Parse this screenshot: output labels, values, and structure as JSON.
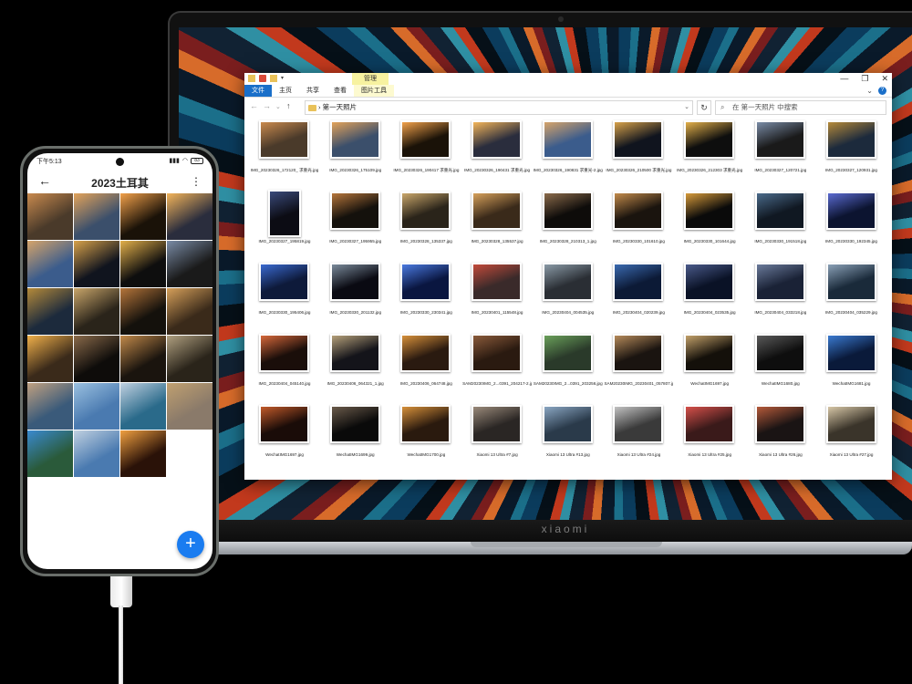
{
  "laptop": {
    "brand": "xiaomi"
  },
  "explorer": {
    "ctx_tab": "管理",
    "tabs": [
      "文件",
      "主页",
      "共享",
      "查看",
      "图片工具"
    ],
    "address": "› 第一天照片",
    "search_placeholder": "在 第一天照片 中搜索",
    "files": [
      {
        "name": "IMG_20230326_172120_ 求重光.jpg",
        "c": [
          "#4a3a2a",
          "#c98a4e"
        ]
      },
      {
        "name": "IMG_20230326_175109.jpg",
        "c": [
          "#3b4f6b",
          "#e3a35a"
        ]
      },
      {
        "name": "IMG_20230326_190417 求重光.jpg",
        "c": [
          "#1a1208",
          "#f2a14a"
        ]
      },
      {
        "name": "IMG_20230326_190431 求重光.jpg",
        "c": [
          "#2a2d3d",
          "#f4b55a"
        ]
      },
      {
        "name": "IMG_20230326_190831 求重光-2.jpg",
        "c": [
          "#3b5c8c",
          "#d6a46a"
        ]
      },
      {
        "name": "IMG_20230326_210500 求重光.jpg",
        "c": [
          "#10141e",
          "#d8a24a"
        ]
      },
      {
        "name": "IMG_20230326_212303 求重光.jpg",
        "c": [
          "#0e0e0e",
          "#e3b04a"
        ]
      },
      {
        "name": "IMG_20230327_120721.jpg",
        "c": [
          "#1a1a1a",
          "#7a8ca6"
        ]
      },
      {
        "name": "IMG_20230327_120931.jpg",
        "c": [
          "#1c2a3c",
          "#b58a3a"
        ]
      },
      {
        "name": "IMG_20230327_195819.jpg",
        "c": [
          "#0c0c14",
          "#3a4a7a"
        ],
        "portrait": true
      },
      {
        "name": "IMG_20230327_195955.jpg",
        "c": [
          "#14110c",
          "#b5753a"
        ]
      },
      {
        "name": "IMG_20230328_135337.jpg",
        "c": [
          "#2a241a",
          "#c9a66a"
        ]
      },
      {
        "name": "IMG_20230328_135537.jpg",
        "c": [
          "#3a2a1a",
          "#d6a05a"
        ]
      },
      {
        "name": "IMG_20230328_210313_1.jpg",
        "c": [
          "#0e0c0a",
          "#8a6a4a"
        ]
      },
      {
        "name": "IMG_20230330_101610.jpg",
        "c": [
          "#1a140e",
          "#c28a4a"
        ]
      },
      {
        "name": "IMG_20230330_101644.jpg",
        "c": [
          "#0a0a0a",
          "#d69a3a"
        ]
      },
      {
        "name": "IMG_20230330_191518.jpg",
        "c": [
          "#101822",
          "#4a6a8a"
        ]
      },
      {
        "name": "IMG_20230330_192345.jpg",
        "c": [
          "#0c1430",
          "#5a6ad0"
        ]
      },
      {
        "name": "IMG_20230330_195406.jpg",
        "c": [
          "#0e1a3a",
          "#3a6ad0"
        ]
      },
      {
        "name": "IMG_20230330_201132.jpg",
        "c": [
          "#0a0a12",
          "#7a8a9a"
        ]
      },
      {
        "name": "IMG_20230330_230341.jpg",
        "c": [
          "#0a1640",
          "#4a7ae0"
        ]
      },
      {
        "name": "IMG_20230401_115548.jpg",
        "c": [
          "#3a2a2a",
          "#c24a3a"
        ]
      },
      {
        "name": "IMG_20230404_004535.jpg",
        "c": [
          "#2a2e34",
          "#8a9aa6"
        ]
      },
      {
        "name": "IMG_20230404_020239.jpg",
        "c": [
          "#0c1a36",
          "#3a6ab0"
        ]
      },
      {
        "name": "IMG_20230404_023535.jpg",
        "c": [
          "#0a1226",
          "#4a5a8a"
        ]
      },
      {
        "name": "IMG_20230404_033218.jpg",
        "c": [
          "#1a2236",
          "#6a7a9a"
        ]
      },
      {
        "name": "IMG_20230404_035229.jpg",
        "c": [
          "#1a2a3a",
          "#8aa0b6"
        ]
      },
      {
        "name": "IMG_20230404_045140.jpg",
        "c": [
          "#1a0e0a",
          "#d6683a"
        ]
      },
      {
        "name": "IMG_20230406_064321_1.jpg",
        "c": [
          "#14141a",
          "#b5a07a"
        ]
      },
      {
        "name": "IMG_20230406_064748.jpg",
        "c": [
          "#2a1a10",
          "#d6903a"
        ]
      },
      {
        "name": "SAM20230IMG_2...0391_204217-2.jpg",
        "c": [
          "#2a1a10",
          "#8a5a3a"
        ]
      },
      {
        "name": "SAM20230IMG_2...0391_203256.jpg",
        "c": [
          "#2a3a2a",
          "#6aa05a"
        ]
      },
      {
        "name": "SAM20230IMG_20230401_057807.jpg",
        "c": [
          "#1a1410",
          "#b58a5a"
        ]
      },
      {
        "name": "WechatIMG1697.jpg",
        "c": [
          "#14100a",
          "#c2a06a"
        ]
      },
      {
        "name": "WechatIMG1680.jpg",
        "c": [
          "#0e0e0e",
          "#5a5a5a"
        ]
      },
      {
        "name": "WechatIMG1681.jpg",
        "c": [
          "#0a1a3a",
          "#3a7ad0"
        ]
      },
      {
        "name": "WechatIMG1697.jpg",
        "c": [
          "#1a0c08",
          "#c25a2a"
        ]
      },
      {
        "name": "WechatIMG1699.jpg",
        "c": [
          "#0a0a0a",
          "#6a5a4a"
        ]
      },
      {
        "name": "WechatIMG1700.jpg",
        "c": [
          "#2a1a0e",
          "#d6903a"
        ]
      },
      {
        "name": "Xiaomi 13 Ultra #7.jpg",
        "c": [
          "#2a2624",
          "#9a8a7a"
        ]
      },
      {
        "name": "Xiaomi 13 Ultra #13.jpg",
        "c": [
          "#2a3a4a",
          "#8aa6c2"
        ]
      },
      {
        "name": "Xiaomi 13 Ultra #24.jpg",
        "c": [
          "#3a3a3a",
          "#c2c2c2"
        ]
      },
      {
        "name": "Xiaomi 13 Ultra #25.jpg",
        "c": [
          "#3a1a1a",
          "#d6504a"
        ]
      },
      {
        "name": "Xiaomi 13 Ultra #26.jpg",
        "c": [
          "#1a1414",
          "#b55a3a"
        ]
      },
      {
        "name": "Xiaomi 13 Ultra #27.jpg",
        "c": [
          "#3a342a",
          "#d6c6a6"
        ]
      }
    ]
  },
  "phone": {
    "time": "下午5:13",
    "battery": "83",
    "album_title": "2023土耳其",
    "tiles": [
      [
        "#4a3a2a",
        "#c98a4e"
      ],
      [
        "#3b4f6b",
        "#e3a35a"
      ],
      [
        "#1a1208",
        "#f2a14a"
      ],
      [
        "#2a2d3d",
        "#f4b55a"
      ],
      [
        "#3b5c8c",
        "#d6a46a"
      ],
      [
        "#10141e",
        "#d8a24a"
      ],
      [
        "#0e0e0e",
        "#e3b04a"
      ],
      [
        "#1a1a1a",
        "#7a8ca6"
      ],
      [
        "#1c2a3c",
        "#b58a3a"
      ],
      [
        "#2a241a",
        "#c9a66a"
      ],
      [
        "#14110c",
        "#b5753a"
      ],
      [
        "#3a2a1a",
        "#d6a05a"
      ],
      [
        "#3a2a1a",
        "#f0b04a"
      ],
      [
        "#0e0c0a",
        "#8a6a4a"
      ],
      [
        "#1a140e",
        "#c28a4a"
      ],
      [
        "#2a241a",
        "#b0a080"
      ],
      [
        "#3a5a7a",
        "#c0a080"
      ],
      [
        "#4a7ab0",
        "#9ac0e0"
      ],
      [
        "#2a6a8a",
        "#c0d0e0"
      ],
      [
        "#8a7a6a",
        "#c0a070"
      ],
      [
        "#2a5a3a",
        "#3a8ad0"
      ],
      [
        "#4a7ab0",
        "#c0d0e0"
      ],
      [
        "#2a1208",
        "#f0a040"
      ]
    ]
  },
  "colors": {
    "accent": "#1a7cf0",
    "file_tab": "#1a6fc9"
  }
}
